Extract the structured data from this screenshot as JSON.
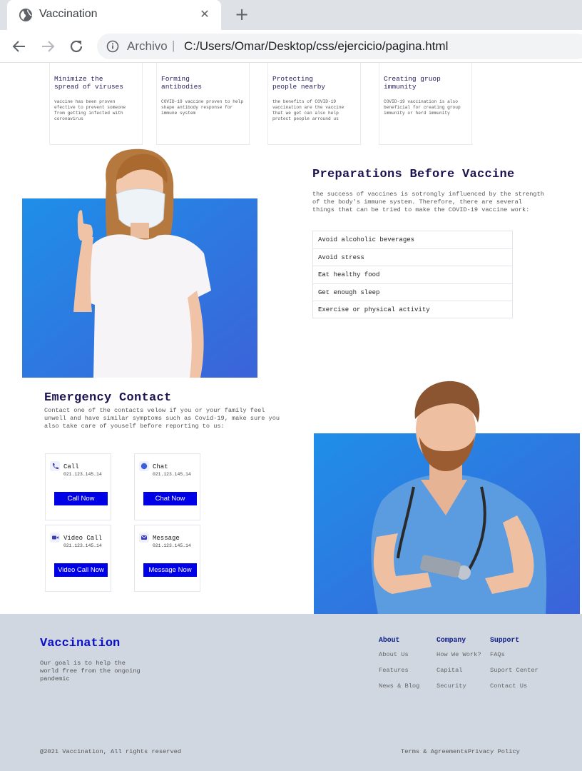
{
  "browser": {
    "tab_title": "Vaccination",
    "omnibox_prefix": "Archivo",
    "omnibox_separator": "|",
    "url": "C:/Users/Omar/Desktop/css/ejercicio/pagina.html"
  },
  "benefits": [
    {
      "title": "Minimize the\nspread of viruses",
      "text": "vaccine has been proven efective to prevent someone from getting infected with coronavirus"
    },
    {
      "title": "Forming\nantibodies",
      "text": "COVID-19 vaccine proven to help shape antibody response for immune system"
    },
    {
      "title": "Protecting\npeople nearby",
      "text": "the benefits of COVID-19 vaccination are the vaccine that we get can also help protect people arround us"
    },
    {
      "title": "Creating gruop\nimmunity",
      "text": "COVID-19 vaccination is also beneficial for creating group immunity or herd immunity"
    }
  ],
  "preparations": {
    "title": "Preparations Before Vaccine",
    "description": "the success of vaccines is sotrongly influenced by the strength of the body's immune system. Therefore, there are several things that can be tried to make the COVID-19 vaccine work:",
    "items": [
      "Avoid alcoholic beverages",
      "Avoid stress",
      "Eat healthy food",
      "Get enough sleep",
      "Exercise or physical activity"
    ]
  },
  "emergency": {
    "title": "Emergency Contact",
    "description": "Contact one of the contacts velow if you or your family feel unwell and have similar symptoms such as Covid-19, make sure you also take care of youself before reporting to us:",
    "contacts": [
      {
        "label": "Call",
        "number": "021.123.145.14",
        "button": "Call Now",
        "icon": "phone-icon"
      },
      {
        "label": "Chat",
        "number": "021.123.145.14",
        "button": "Chat Now",
        "icon": "chat-icon"
      },
      {
        "label": "Video Call",
        "number": "021.123.145.14",
        "button": "Video Call Now",
        "icon": "video-icon"
      },
      {
        "label": "Message",
        "number": "021.123.145.14",
        "button": "Message Now",
        "icon": "mail-icon"
      }
    ]
  },
  "footer": {
    "brand": "Vaccination",
    "tagline": "Our goal is to help the world free from the ongoing pandemic",
    "columns": [
      {
        "heading": "About",
        "links": [
          "About Us",
          "Features",
          "News & Blog"
        ]
      },
      {
        "heading": "Company",
        "links": [
          "How We Work?",
          "Capital",
          "Security"
        ]
      },
      {
        "heading": "Support",
        "links": [
          "FAQs",
          "Suport Center",
          "Contact Us"
        ]
      }
    ],
    "copyright": "@2021 Vaccination, All rights reserved",
    "terms": "Terms & Agreements",
    "privacy": "Privacy Policy"
  },
  "colors": {
    "accent": "#0000e6",
    "heading": "#1d1450",
    "brand": "#0a10c8",
    "footer_bg": "#d1d7e0",
    "photo_bg": "#1a73e8"
  }
}
